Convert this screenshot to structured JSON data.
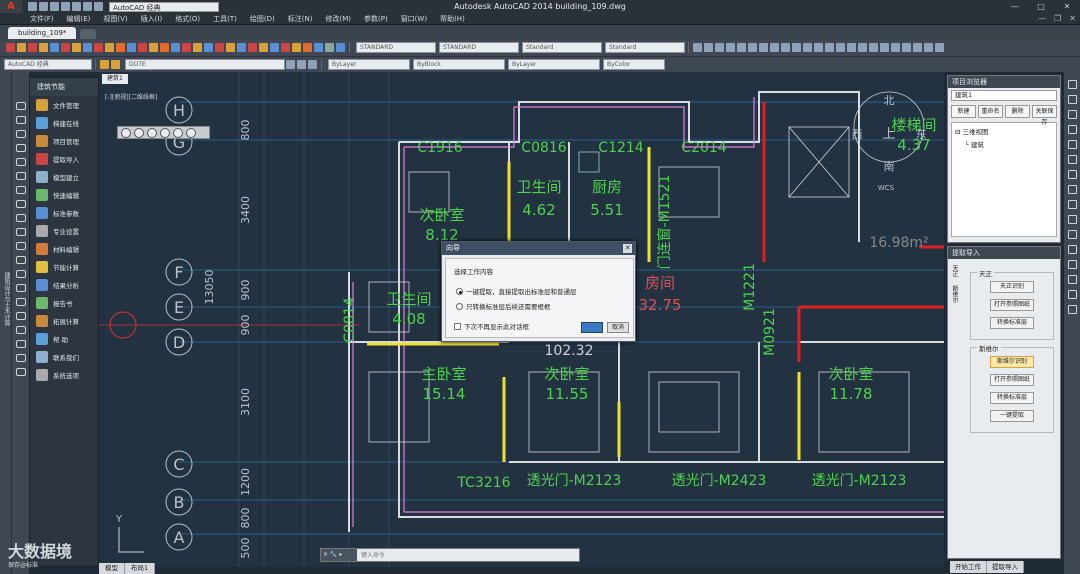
{
  "window": {
    "title": "Autodesk AutoCAD 2014    building_109.dwg",
    "workspace": "AutoCAD 经典",
    "min": "—",
    "max": "□",
    "close": "✕"
  },
  "menu": [
    "文件(F)",
    "编辑(E)",
    "视图(V)",
    "插入(I)",
    "格式(O)",
    "工具(T)",
    "绘图(D)",
    "标注(N)",
    "修改(M)",
    "参数(P)",
    "窗口(W)",
    "帮助(H)"
  ],
  "file_tab": "building_109*",
  "toolbar": {
    "style1": "STANDARD",
    "style2": "STANDARD",
    "style3": "Standard",
    "style4": "Standard",
    "workspace2": "AutoCAD 经典",
    "layer": "DOTE",
    "color": "ByLayer",
    "linetype": "ByBlock",
    "lineweight": "ByLayer",
    "plotstyle": "ByColor"
  },
  "left_vertical_label": "建筑设计与土木计算",
  "arch_panel": {
    "title": "建筑节能",
    "items": [
      "文件管理",
      "梯建在线",
      "项目管理",
      "提取导入",
      "模型建立",
      "快速编辑",
      "标准参数",
      "专业设置",
      "材料编辑",
      "节能计算",
      "结果分析",
      "报告书",
      "拓展计算",
      "帮  助",
      "联系我们",
      "系统选项"
    ]
  },
  "drawing": {
    "model_tab": "建筑1",
    "view_label": "[-][俯视][二维线框]",
    "grid_rows": [
      "H",
      "G",
      "F",
      "E",
      "D",
      "C",
      "B",
      "A"
    ],
    "dims": [
      "800",
      "3400",
      "13050",
      "900",
      "900",
      "3100",
      "1200",
      "800",
      "500"
    ],
    "rooms": [
      {
        "name": "次卧室",
        "area": "8.12"
      },
      {
        "name": "卫生间",
        "area": "4.62"
      },
      {
        "name": "厨房",
        "area": "5.51"
      },
      {
        "name": "卫生间",
        "area": "4.08"
      },
      {
        "name": "主卧室",
        "area": "15.14"
      },
      {
        "name": "次卧室",
        "area": "11.55"
      },
      {
        "name": "次卧室",
        "area": "11.78"
      },
      {
        "name": "房间",
        "area": "32.75"
      },
      {
        "name": "楼梯间",
        "area": "4.37"
      }
    ],
    "labels": [
      "C1916",
      "C0816",
      "C1214",
      "C2014",
      "门连窗-M1521",
      "C0814",
      "M1221",
      "M0921",
      "TC3216",
      "透光门-M2123",
      "透光门-M2423",
      "透光门-M2123",
      "102.32",
      "16.98m²",
      "北",
      "南",
      "西",
      "东",
      "上",
      "WCS",
      "Y"
    ]
  },
  "cmdline": {
    "icons": "✕ 🔧 ▸",
    "placeholder": "键入命令"
  },
  "layout_tabs": [
    "模型",
    "布局1"
  ],
  "watermark": {
    "brand": "大数据境",
    "sub": "保存@标准"
  },
  "project_browser": {
    "title": "项目浏览器",
    "selected": "建筑1",
    "buttons": [
      "新建",
      "重命名",
      "删除",
      "关联保存"
    ],
    "tree": [
      "三维视图",
      "建筑"
    ]
  },
  "extract_panel": {
    "title": "提取导入",
    "side_tabs": [
      "天正",
      "斯维尔"
    ],
    "group1": {
      "title": "天正",
      "buttons": [
        "天正识别",
        "打开参照图纸",
        "转换标准层"
      ]
    },
    "group2": {
      "title": "斯维尔",
      "buttons": [
        "斯维尔识别",
        "打开参照图纸",
        "转换标准层",
        "一键提取"
      ]
    }
  },
  "right_tabs": [
    "开始工作",
    "提取导入"
  ],
  "dialog": {
    "title": "向导",
    "prompt": "选择工作内容",
    "option1": "一键提取，直接提取出标准层和普通层",
    "option2": "只转换标准层后续还需要框框",
    "checkbox": "下次不再显示此对话框",
    "ok": "",
    "cancel": "取消",
    "close": "✕"
  }
}
